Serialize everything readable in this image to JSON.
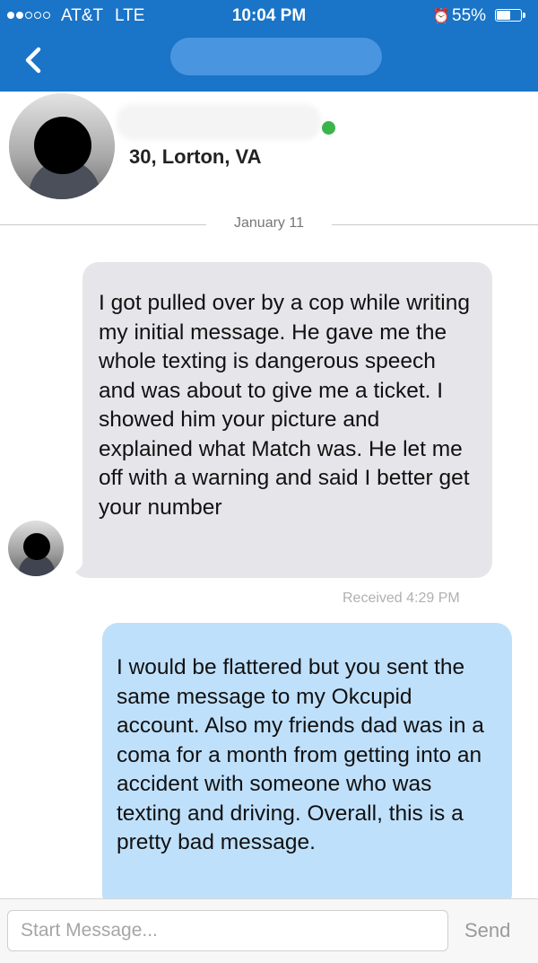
{
  "status_bar": {
    "carrier": "AT&T",
    "network": "LTE",
    "time": "10:04 PM",
    "battery": "55%",
    "battery_level": 0.55,
    "signal_bars_filled": 2,
    "signal_bars_total": 5
  },
  "nav": {
    "back_icon": "chevron-left-icon"
  },
  "profile": {
    "location": "30, Lorton, VA",
    "online": true,
    "online_color": "#3ab54a"
  },
  "conversation": {
    "date": "January 11",
    "messages": [
      {
        "direction": "received",
        "text": "I got pulled over by a cop while writing my initial message. He gave me the whole texting is dangerous speech and was about to give me a ticket. I showed him your picture and explained what Match was. He let me off with a warning and said I better get your number",
        "status": "Received 4:29 PM"
      },
      {
        "direction": "sent",
        "text": "I would be flattered but you sent the same message to my Okcupid account. Also my friends dad was in a coma for a month from getting into an accident with someone who was texting and driving. Overall, this is a pretty bad message."
      }
    ]
  },
  "composer": {
    "placeholder": "Start Message...",
    "value": "",
    "send_label": "Send"
  },
  "colors": {
    "header": "#1a74c7",
    "received_bubble": "#e6e6ea",
    "sent_bubble": "#bfe0fb"
  }
}
